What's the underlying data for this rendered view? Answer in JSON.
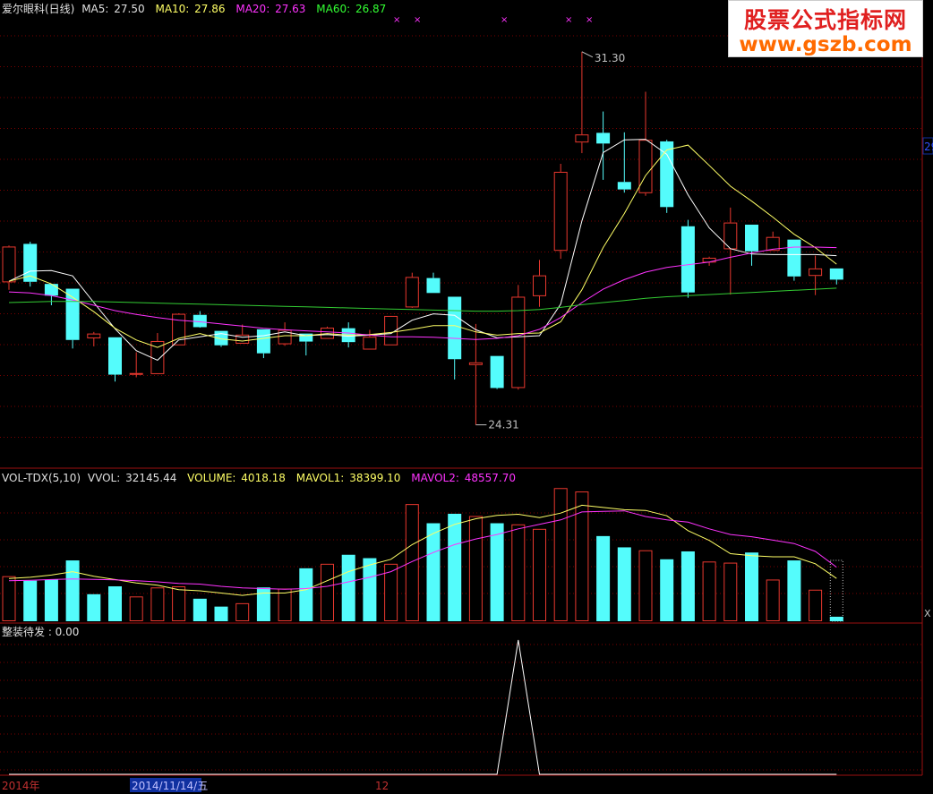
{
  "watermark": {
    "title": "股票公式指标网",
    "url": "www.gszb.com"
  },
  "price_header": {
    "name": "爱尔眼科(日线)",
    "ma5_label": "MA5:",
    "ma5_value": "27.50",
    "ma10_label": "MA10:",
    "ma10_value": "27.86",
    "ma20_label": "MA20:",
    "ma20_value": "27.63",
    "ma60_label": "MA60:",
    "ma60_value": "26.87"
  },
  "volume_header": {
    "name": "VOL-TDX(5,10)",
    "vvol_label": "VVOL:",
    "vvol_value": "32145.44",
    "volume_label": "VOLUME:",
    "volume_value": "4018.18",
    "mavol1_label": "MAVOL1:",
    "mavol1_value": "38399.10",
    "mavol2_label": "MAVOL2:",
    "mavol2_value": "48557.70"
  },
  "indicator_header": {
    "text": "整装待发 : 0.00"
  },
  "axis": {
    "x_labels": [
      "2014年",
      "2014/11/14/五",
      "12"
    ],
    "right_price_tick": "29",
    "right_vol_tick": "X"
  },
  "annotations": {
    "high": "31.30",
    "low": "24.31"
  },
  "colors": {
    "up": "#e8382e",
    "down": "#54fcfc",
    "ma5": "#ffffff",
    "ma10": "#ffff66",
    "ma20": "#ff33ff",
    "ma60": "#33cc33",
    "grid": "#7a0000",
    "border": "#9b1010",
    "text_grey": "#c0c0c0",
    "date_highlight": "#1030a0"
  },
  "chart_data": {
    "type": "candlestick",
    "ylim": [
      23.8,
      31.9
    ],
    "candles": [
      {
        "o": 26.98,
        "h": 27.67,
        "l": 26.84,
        "c": 27.65
      },
      {
        "o": 27.7,
        "h": 27.74,
        "l": 26.9,
        "c": 26.99
      },
      {
        "o": 26.95,
        "h": 26.95,
        "l": 26.55,
        "c": 26.73
      },
      {
        "o": 26.86,
        "h": 26.86,
        "l": 25.74,
        "c": 25.9
      },
      {
        "o": 25.93,
        "h": 26.05,
        "l": 25.78,
        "c": 26.02
      },
      {
        "o": 25.95,
        "h": 25.95,
        "l": 25.12,
        "c": 25.25
      },
      {
        "o": 25.26,
        "h": 25.67,
        "l": 25.2,
        "c": 25.28
      },
      {
        "o": 25.26,
        "h": 26.03,
        "l": 25.26,
        "c": 25.88
      },
      {
        "o": 25.8,
        "h": 26.4,
        "l": 25.8,
        "c": 26.39
      },
      {
        "o": 26.37,
        "h": 26.44,
        "l": 26.13,
        "c": 26.14
      },
      {
        "o": 26.07,
        "h": 26.07,
        "l": 25.77,
        "c": 25.8
      },
      {
        "o": 25.83,
        "h": 26.19,
        "l": 25.83,
        "c": 26.0
      },
      {
        "o": 26.1,
        "h": 26.1,
        "l": 25.56,
        "c": 25.65
      },
      {
        "o": 25.82,
        "h": 26.23,
        "l": 25.79,
        "c": 26.09
      },
      {
        "o": 26.02,
        "h": 26.02,
        "l": 25.61,
        "c": 25.87
      },
      {
        "o": 25.92,
        "h": 26.15,
        "l": 25.92,
        "c": 26.13
      },
      {
        "o": 26.12,
        "h": 26.23,
        "l": 25.76,
        "c": 25.86
      },
      {
        "o": 25.72,
        "h": 26.09,
        "l": 25.72,
        "c": 25.96
      },
      {
        "o": 25.8,
        "h": 26.3,
        "l": 25.8,
        "c": 26.35
      },
      {
        "o": 26.51,
        "h": 27.16,
        "l": 26.5,
        "c": 27.08
      },
      {
        "o": 27.06,
        "h": 27.16,
        "l": 26.78,
        "c": 26.78
      },
      {
        "o": 26.71,
        "h": 26.71,
        "l": 25.16,
        "c": 25.54
      },
      {
        "o": 25.43,
        "h": 26.2,
        "l": 24.31,
        "c": 25.48
      },
      {
        "o": 25.6,
        "h": 25.6,
        "l": 24.98,
        "c": 25.0
      },
      {
        "o": 25.0,
        "h": 26.93,
        "l": 24.97,
        "c": 26.71
      },
      {
        "o": 26.72,
        "h": 27.4,
        "l": 26.52,
        "c": 27.11
      },
      {
        "o": 27.57,
        "h": 29.2,
        "l": 27.42,
        "c": 29.05
      },
      {
        "o": 29.6,
        "h": 31.3,
        "l": 29.4,
        "c": 29.75
      },
      {
        "o": 29.78,
        "h": 30.18,
        "l": 28.9,
        "c": 29.58
      },
      {
        "o": 28.86,
        "h": 29.79,
        "l": 28.66,
        "c": 28.72
      },
      {
        "o": 28.65,
        "h": 30.55,
        "l": 28.6,
        "c": 29.65
      },
      {
        "o": 29.62,
        "h": 29.65,
        "l": 28.28,
        "c": 28.39
      },
      {
        "o": 28.03,
        "h": 28.15,
        "l": 26.69,
        "c": 26.79
      },
      {
        "o": 27.35,
        "h": 27.46,
        "l": 27.29,
        "c": 27.44
      },
      {
        "o": 27.6,
        "h": 28.38,
        "l": 26.75,
        "c": 28.1
      },
      {
        "o": 28.06,
        "h": 28.06,
        "l": 27.29,
        "c": 27.56
      },
      {
        "o": 27.57,
        "h": 27.93,
        "l": 27.57,
        "c": 27.83
      },
      {
        "o": 27.78,
        "h": 27.78,
        "l": 27.01,
        "c": 27.09
      },
      {
        "o": 27.1,
        "h": 27.48,
        "l": 26.74,
        "c": 27.24
      },
      {
        "o": 27.24,
        "h": 27.24,
        "l": 26.94,
        "c": 27.03
      }
    ],
    "ma_series": [
      {
        "name": "MA5",
        "values": [
          27.0,
          27.19,
          27.2,
          27.1,
          26.6,
          26.11,
          25.7,
          25.52,
          25.9,
          25.96,
          26.02,
          25.95,
          25.98,
          26.05,
          25.98,
          26.0,
          25.97,
          25.99,
          26.02,
          26.27,
          26.39,
          26.36,
          26.09,
          25.94,
          25.96,
          25.98,
          26.57,
          28.13,
          29.41,
          29.65,
          29.66,
          29.38,
          28.62,
          28.0,
          27.61,
          27.51,
          27.5,
          27.5,
          27.5,
          27.48
        ]
      },
      {
        "name": "MA10",
        "values": [
          27.0,
          27.1,
          26.95,
          26.7,
          26.43,
          26.12,
          25.9,
          25.76,
          25.93,
          26.02,
          25.92,
          25.88,
          25.93,
          25.98,
          25.98,
          26.02,
          25.99,
          26.0,
          26.04,
          26.1,
          26.17,
          26.17,
          26.05,
          25.99,
          26.02,
          26.03,
          26.24,
          26.84,
          27.63,
          28.27,
          28.98,
          29.46,
          29.55,
          29.17,
          28.78,
          28.5,
          28.2,
          27.88,
          27.63,
          27.32
        ]
      },
      {
        "name": "MA20",
        "values": [
          26.8,
          26.78,
          26.73,
          26.65,
          26.55,
          26.45,
          26.38,
          26.32,
          26.27,
          26.24,
          26.2,
          26.16,
          26.12,
          26.09,
          26.07,
          26.05,
          26.03,
          25.99,
          25.96,
          25.96,
          25.95,
          25.93,
          25.91,
          25.93,
          25.98,
          26.1,
          26.32,
          26.6,
          26.85,
          27.03,
          27.17,
          27.26,
          27.31,
          27.36,
          27.45,
          27.53,
          27.6,
          27.64,
          27.64,
          27.63
        ]
      },
      {
        "name": "MA60",
        "values": [
          26.6,
          26.61,
          26.62,
          26.62,
          26.62,
          26.61,
          26.6,
          26.59,
          26.58,
          26.57,
          26.56,
          26.55,
          26.54,
          26.53,
          26.52,
          26.51,
          26.5,
          26.49,
          26.48,
          26.47,
          26.46,
          26.45,
          26.44,
          26.44,
          26.45,
          26.47,
          26.51,
          26.56,
          26.6,
          26.64,
          26.68,
          26.71,
          26.73,
          26.75,
          26.77,
          26.79,
          26.81,
          26.83,
          26.85,
          26.87
        ]
      }
    ],
    "volume": {
      "ylim": [
        0,
        60000
      ],
      "bars": [
        {
          "v": 20000,
          "up": true
        },
        {
          "v": 18000,
          "up": false
        },
        {
          "v": 18500,
          "up": false
        },
        {
          "v": 27000,
          "up": false
        },
        {
          "v": 12000,
          "up": false
        },
        {
          "v": 15500,
          "up": false
        },
        {
          "v": 11000,
          "up": true
        },
        {
          "v": 15000,
          "up": true
        },
        {
          "v": 15500,
          "up": true
        },
        {
          "v": 10000,
          "up": false
        },
        {
          "v": 6500,
          "up": false
        },
        {
          "v": 8000,
          "up": true
        },
        {
          "v": 15000,
          "up": false
        },
        {
          "v": 14500,
          "up": true
        },
        {
          "v": 23500,
          "up": false
        },
        {
          "v": 25500,
          "up": true
        },
        {
          "v": 29500,
          "up": false
        },
        {
          "v": 28000,
          "up": false
        },
        {
          "v": 25500,
          "up": true
        },
        {
          "v": 52000,
          "up": true
        },
        {
          "v": 43500,
          "up": false
        },
        {
          "v": 47700,
          "up": false
        },
        {
          "v": 46700,
          "up": true
        },
        {
          "v": 43500,
          "up": false
        },
        {
          "v": 43000,
          "up": true
        },
        {
          "v": 41000,
          "up": true
        },
        {
          "v": 59100,
          "up": true
        },
        {
          "v": 57600,
          "up": true
        },
        {
          "v": 37800,
          "up": false
        },
        {
          "v": 32800,
          "up": false
        },
        {
          "v": 31500,
          "up": true
        },
        {
          "v": 27500,
          "up": false
        },
        {
          "v": 31000,
          "up": false
        },
        {
          "v": 26500,
          "up": true
        },
        {
          "v": 26000,
          "up": true
        },
        {
          "v": 30500,
          "up": false
        },
        {
          "v": 18500,
          "up": true
        },
        {
          "v": 27000,
          "up": false
        },
        {
          "v": 14000,
          "up": true
        },
        {
          "v": 2000,
          "up": false
        }
      ],
      "mavol1": [
        19000,
        19500,
        20500,
        22000,
        20000,
        18500,
        17000,
        16000,
        14000,
        13500,
        12500,
        11500,
        12500,
        12500,
        14000,
        18000,
        22000,
        25000,
        27500,
        34000,
        39000,
        43000,
        45500,
        47000,
        47500,
        46000,
        48000,
        51500,
        50500,
        49500,
        49200,
        46800,
        40200,
        35900,
        30000,
        29100,
        28600,
        28600,
        25500,
        19000
      ],
      "mavol2": [
        18000,
        18200,
        18500,
        18800,
        18600,
        18400,
        18000,
        17500,
        16800,
        16500,
        15500,
        14800,
        14500,
        14200,
        14500,
        15500,
        17500,
        19500,
        22000,
        26500,
        30500,
        34000,
        36500,
        38500,
        41000,
        43000,
        45000,
        48500,
        48800,
        49000,
        46500,
        45000,
        44000,
        41000,
        38500,
        37500,
        36000,
        34500,
        31000,
        24000
      ]
    },
    "indicator": {
      "ylim": [
        0,
        1
      ],
      "values": [
        0,
        0,
        0,
        0,
        0,
        0,
        0,
        0,
        0,
        0,
        0,
        0,
        0,
        0,
        0,
        0,
        0,
        0,
        0,
        0,
        0,
        0,
        0,
        0,
        1,
        0,
        0,
        0,
        0,
        0,
        0,
        0,
        0,
        0,
        0,
        0,
        0,
        0,
        0,
        0
      ]
    }
  }
}
